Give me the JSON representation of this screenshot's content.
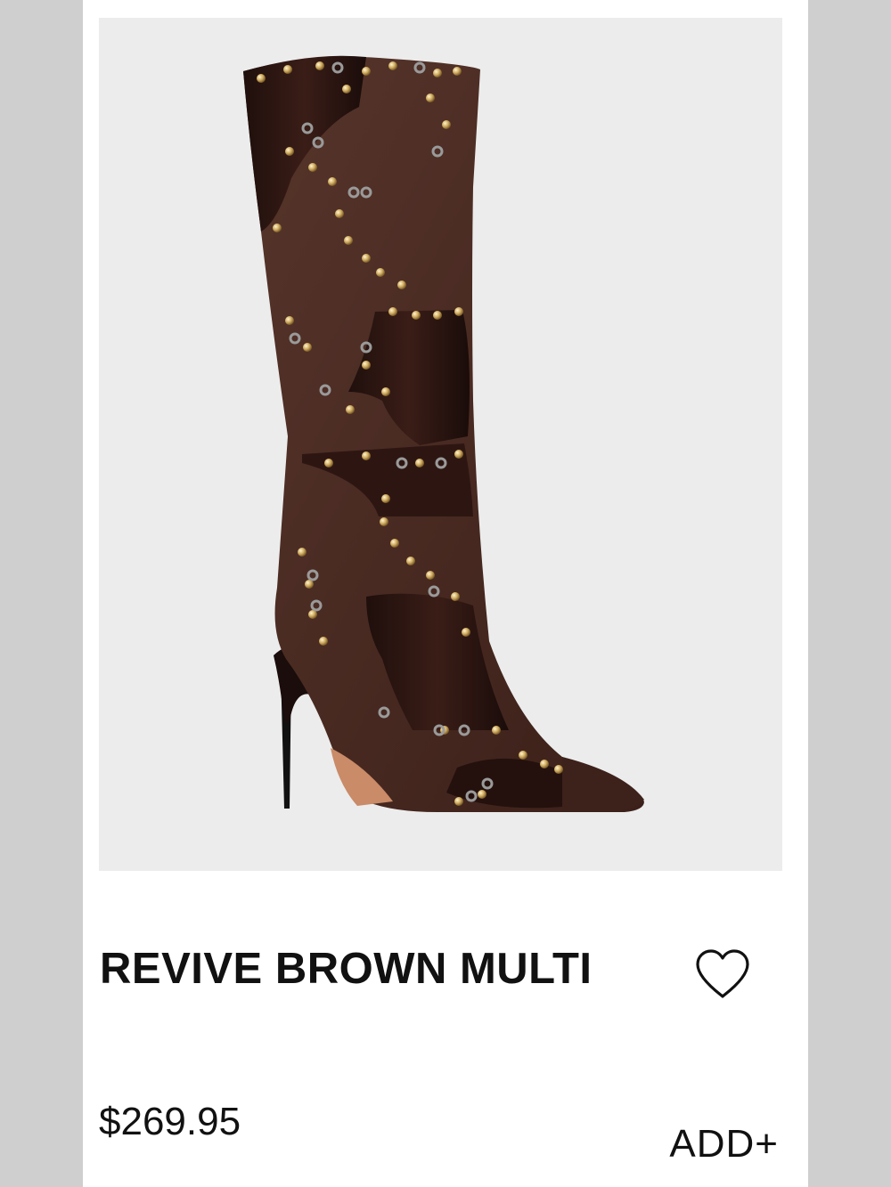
{
  "product": {
    "name": "REVIVE BROWN MULTI",
    "price": "$269.95",
    "image_alt": "Brown multi patchwork studded knee-high stiletto boot",
    "image_icon": "boot-image"
  },
  "actions": {
    "wishlist_icon": "heart-outline-icon",
    "add_label": "ADD+"
  },
  "colors": {
    "page_background": "#cfcfcf",
    "card_background": "#ffffff",
    "image_background": "#ececec",
    "text": "#111111",
    "boot_leather_dark": "#2a1512",
    "boot_suede": "#4a2a22",
    "stud_gold": "#c9a55c",
    "eyelet_silver": "#9a9a9a"
  }
}
